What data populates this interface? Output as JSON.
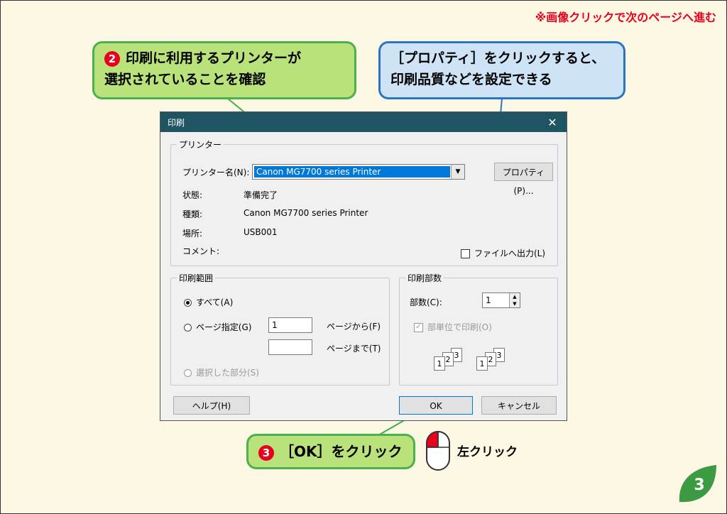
{
  "nav_hint": "※画像クリックで次のページへ進む",
  "callouts": {
    "step2_line1": "印刷に利用するプリンターが",
    "step2_line2": "選択されていることを確認",
    "step2_num": "2",
    "props_line1": "［プロパティ］をクリックすると、",
    "props_line2": "印刷品質などを設定できる",
    "step3_num": "3",
    "step3_text": "［OK］をクリック",
    "left_click": "左クリック"
  },
  "dialog": {
    "title": "印刷",
    "printer_group": "プリンター",
    "printer_name_label": "プリンター名(N):",
    "printer_name_value": "Canon MG7700 series Printer",
    "properties_button": "プロパティ(P)...",
    "status_label": "状態:",
    "status_value": "準備完了",
    "type_label": "種類:",
    "type_value": "Canon MG7700 series Printer",
    "location_label": "場所:",
    "location_value": "USB001",
    "comment_label": "コメント:",
    "print_to_file": "ファイルへ出力(L)",
    "range_group": "印刷範囲",
    "range_all": "すべて(A)",
    "range_pages": "ページ指定(G)",
    "page_from_value": "1",
    "page_from_label": "ページから(F)",
    "page_to_value": "",
    "page_to_label": "ページまで(T)",
    "range_selection": "選択した部分(S)",
    "copies_group": "印刷部数",
    "copies_label": "部数(C):",
    "copies_value": "1",
    "collate": "部単位で印刷(O)",
    "help_button": "ヘルプ(H)",
    "ok_button": "OK",
    "cancel_button": "キャンセル"
  },
  "page_number": "3",
  "colors": {
    "accent_red": "#e8001c",
    "green_callout": "#b9e37a",
    "blue_callout": "#cfe3f6",
    "titlebar": "#1f5462",
    "selection": "#0078d7"
  }
}
